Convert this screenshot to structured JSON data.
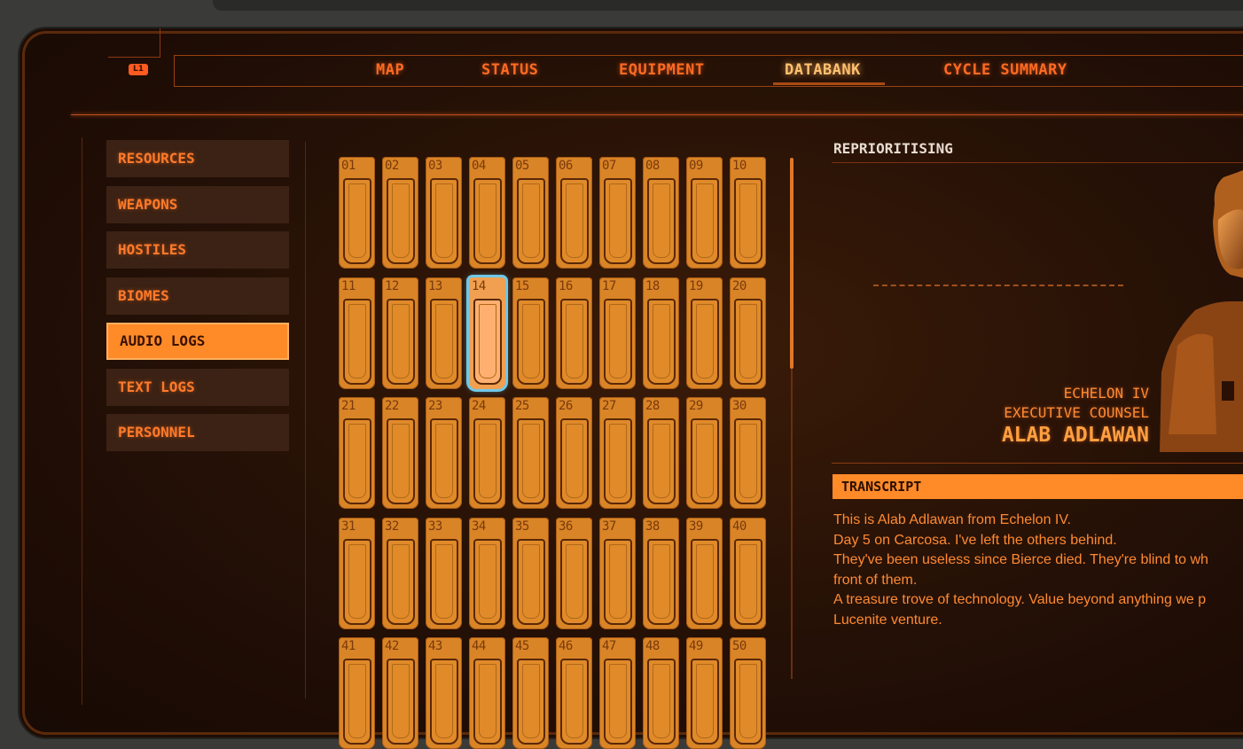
{
  "colors": {
    "accent": "#ff8a28",
    "text_orange": "#ff6a22",
    "selection": "#6fc8e8"
  },
  "nav": {
    "badge": "L1",
    "tabs": [
      {
        "label": "MAP",
        "active": false
      },
      {
        "label": "STATUS",
        "active": false
      },
      {
        "label": "EQUIPMENT",
        "active": false
      },
      {
        "label": "DATABANK",
        "active": true
      },
      {
        "label": "CYCLE SUMMARY",
        "active": false
      }
    ]
  },
  "sidebar": {
    "items": [
      {
        "label": "RESOURCES",
        "active": false
      },
      {
        "label": "WEAPONS",
        "active": false
      },
      {
        "label": "HOSTILES",
        "active": false
      },
      {
        "label": "BIOMES",
        "active": false
      },
      {
        "label": "AUDIO LOGS",
        "active": true
      },
      {
        "label": "TEXT LOGS",
        "active": false
      },
      {
        "label": "PERSONNEL",
        "active": false
      }
    ]
  },
  "grid": {
    "numbers": [
      "01",
      "02",
      "03",
      "04",
      "05",
      "06",
      "07",
      "08",
      "09",
      "10",
      "11",
      "12",
      "13",
      "14",
      "15",
      "16",
      "17",
      "18",
      "19",
      "20",
      "21",
      "22",
      "23",
      "24",
      "25",
      "26",
      "27",
      "28",
      "29",
      "30",
      "31",
      "32",
      "33",
      "34",
      "35",
      "36",
      "37",
      "38",
      "39",
      "40",
      "41",
      "42",
      "43",
      "44",
      "45",
      "46",
      "47",
      "48",
      "49",
      "50"
    ],
    "selected": "14"
  },
  "detail": {
    "title": "REPRIORITISING",
    "speaker_org": "ECHELON IV",
    "speaker_role": "EXECUTIVE COUNSEL",
    "speaker_name": "ALAB ADLAWAN",
    "portrait_icon": "soldier-portrait",
    "transcript_label": "TRANSCRIPT",
    "transcript_lines": [
      "This is Alab Adlawan from Echelon IV.",
      "Day 5 on Carcosa. I've left the others behind.",
      "They've been useless since Bierce died. They're blind to wh",
      "front of them.",
      "A treasure trove of technology. Value beyond anything we p",
      "Lucenite venture."
    ]
  }
}
